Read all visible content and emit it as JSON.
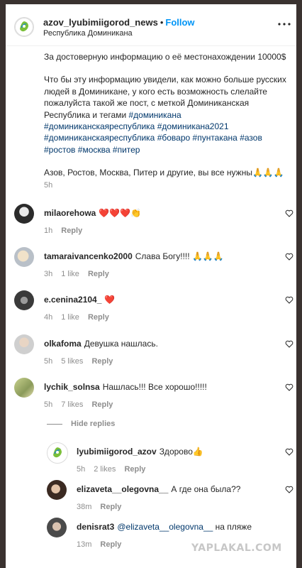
{
  "header": {
    "username": "azov_lyubimiigorod_news",
    "separator": "•",
    "follow_label": "Follow",
    "location": "Республика Доминикана"
  },
  "caption": {
    "line1": "За достоверную информацию о её местонахождении 10000$",
    "para2_text": "Что бы эту информацию увидели, как можно больше русских людей в Доминикане, у кого есть возможность слелайте пожалуйста такой же пост, с меткой Доминиканская Республика и тегами ",
    "tags": [
      "#доминикана",
      "#доминиканскаяреспублика",
      "#доминикана2021",
      "#доминиканскаяреспублика",
      "#боваро",
      "#пунтакана",
      "#азов",
      "#ростов",
      "#москва",
      "#питер"
    ],
    "para3_text": "Азов, Ростов, Москва, Питер и другие, вы все нужны",
    "para3_emoji": "🙏🙏🙏",
    "time": "5h"
  },
  "comments": [
    {
      "user": "milaorehowa",
      "text": "",
      "emoji": "❤️❤️❤️👏",
      "time": "1h",
      "likes": "",
      "reply": "Reply"
    },
    {
      "user": "tamaraivancenko2000",
      "text": "Слава Богу!!!!",
      "emoji": "🙏🙏🙏",
      "time": "3h",
      "likes": "1 like",
      "reply": "Reply"
    },
    {
      "user": "e.cenina2104_",
      "text": "",
      "emoji": "❤️",
      "time": "4h",
      "likes": "1 like",
      "reply": "Reply"
    },
    {
      "user": "olkafoma",
      "text": "Девушка нашлась.",
      "emoji": "",
      "time": "5h",
      "likes": "5 likes",
      "reply": "Reply"
    },
    {
      "user": "lychik_solnsa",
      "text": "Нашлась!!! Все хорошо!!!!!",
      "emoji": "",
      "time": "5h",
      "likes": "7 likes",
      "reply": "Reply"
    }
  ],
  "hide_replies_label": "Hide replies",
  "replies": [
    {
      "user": "lyubimiigorod_azov",
      "text": "Здорово",
      "emoji": "👍",
      "time": "5h",
      "likes": "2 likes",
      "reply": "Reply"
    },
    {
      "user": "elizaveta__olegovna__",
      "text": "А где она была??",
      "emoji": "",
      "time": "38m",
      "likes": "",
      "reply": "Reply"
    },
    {
      "user": "denisrat3",
      "mention": "@elizaveta__olegovna__",
      "text": "на пляже",
      "emoji": "",
      "time": "13m",
      "likes": "",
      "reply": "Reply"
    }
  ],
  "watermark": "YAPLAKAL.COM",
  "colors": {
    "link": "#00376b",
    "follow": "#0095f6",
    "meta": "#8e8e8e"
  }
}
